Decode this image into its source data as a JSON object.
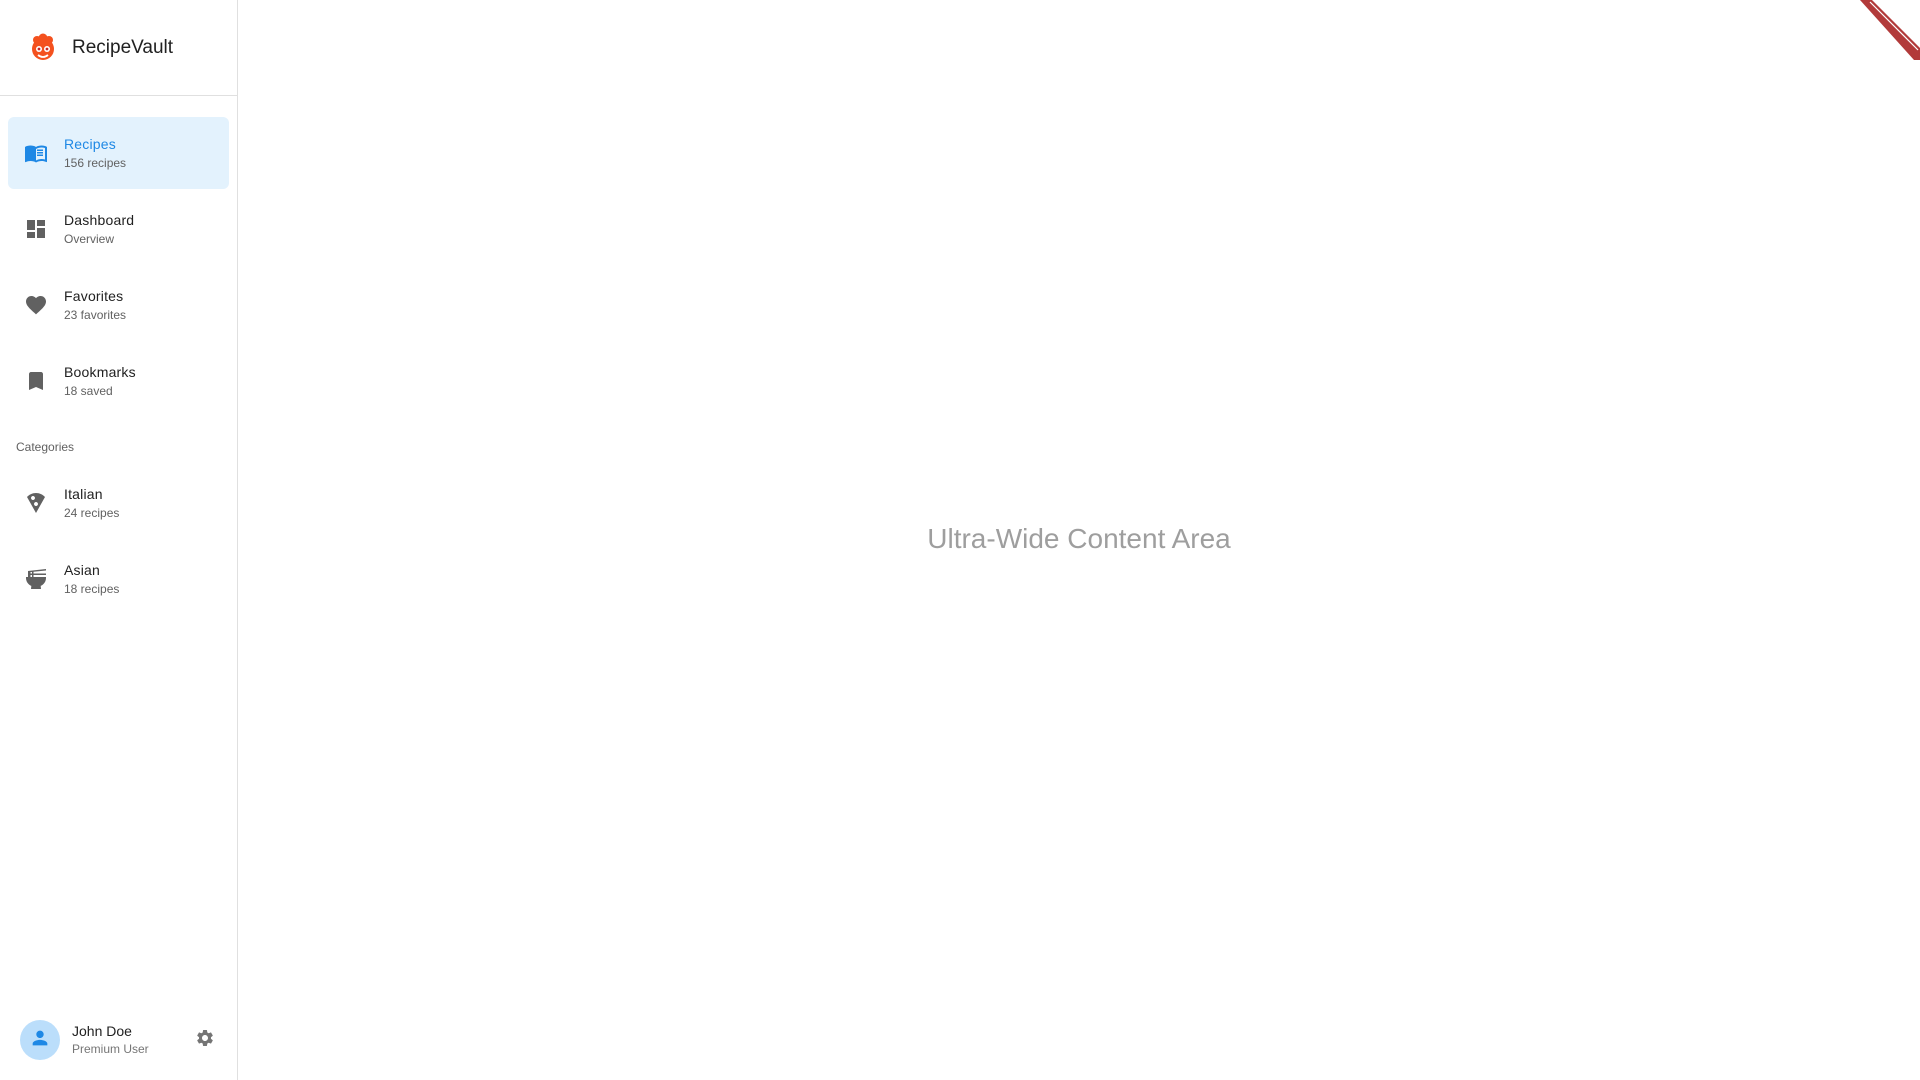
{
  "app": {
    "name": "RecipeVault"
  },
  "nav": [
    {
      "label": "Recipes",
      "sub": "156 recipes",
      "icon": "menu-book-icon",
      "active": true
    },
    {
      "label": "Dashboard",
      "sub": "Overview",
      "icon": "dashboard-icon",
      "active": false
    },
    {
      "label": "Favorites",
      "sub": "23 favorites",
      "icon": "heart-icon",
      "active": false
    },
    {
      "label": "Bookmarks",
      "sub": "18 saved",
      "icon": "bookmark-icon",
      "active": false
    }
  ],
  "categories": {
    "title": "Categories",
    "items": [
      {
        "label": "Italian",
        "sub": "24 recipes",
        "icon": "pizza-icon"
      },
      {
        "label": "Asian",
        "sub": "18 recipes",
        "icon": "ramen-bowl-icon"
      }
    ]
  },
  "user": {
    "name": "John Doe",
    "role": "Premium User"
  },
  "main": {
    "title": "Ultra-Wide Content Area"
  },
  "colors": {
    "accent": "#1e88e5",
    "active_bg": "#e3f2fd",
    "logo": "#f4511e",
    "ribbon": "#b23a3a"
  }
}
